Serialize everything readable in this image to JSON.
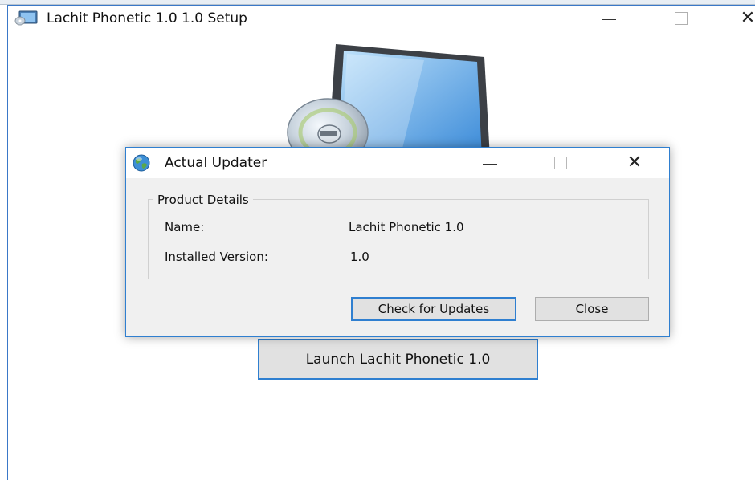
{
  "main_window": {
    "title": "Lachit Phonetic 1.0 1.0 Setup",
    "launch_label": "Launch Lachit Phonetic 1.0"
  },
  "updater_dialog": {
    "title": "Actual Updater",
    "group_title": "Product Details",
    "fields": [
      {
        "label": "Name:",
        "value": "Lachit Phonetic 1.0"
      },
      {
        "label": "Installed Version:",
        "value": "1.0"
      }
    ],
    "buttons": {
      "check_updates": "Check for Updates",
      "close": "Close"
    }
  },
  "caption_icons": {
    "minimize": "minimize-icon",
    "maximize": "maximize-icon",
    "close": "close-icon",
    "close_glyph": "✕"
  },
  "colors": {
    "accent": "#2f7fd0",
    "dialog_bg": "#f0f0f0",
    "button_bg": "#e1e1e1"
  }
}
